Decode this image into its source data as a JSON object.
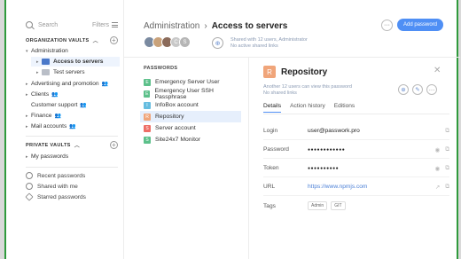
{
  "sidebar": {
    "search_placeholder": "Search",
    "filters_label": "Filters",
    "org_vaults_title": "ORGANIZATION VAULTS",
    "org_items": [
      {
        "label": "Administration"
      },
      {
        "label": "Access to servers"
      },
      {
        "label": "Test servers"
      },
      {
        "label": "Advertising and promotion"
      },
      {
        "label": "Clients"
      },
      {
        "label": "Customer support"
      },
      {
        "label": "Finance"
      },
      {
        "label": "Mail accounts"
      }
    ],
    "private_vaults_title": "PRIVATE VAULTS",
    "private_items": [
      {
        "label": "My passwords"
      }
    ],
    "utilities": [
      {
        "label": "Recent passwords"
      },
      {
        "label": "Shared with me"
      },
      {
        "label": "Starred passwords"
      }
    ]
  },
  "header": {
    "breadcrumb_parent": "Administration",
    "breadcrumb_current": "Access to servers",
    "avatar_letters": [
      "",
      "",
      "",
      "C",
      "S"
    ],
    "shared_line1": "Shared with 12 users, Administrator",
    "shared_line2": "No active shared links",
    "more_glyph": "···",
    "add_password_label": "Add password"
  },
  "list": {
    "title": "PASSWORDS",
    "items": [
      {
        "badge": "E",
        "label": "Emergency Server User",
        "color": "#5cc08a"
      },
      {
        "badge": "E",
        "label": "Emergency User SSH Passphrase",
        "color": "#5cc08a"
      },
      {
        "badge": "I",
        "label": "InfoBox account",
        "color": "#66bde0"
      },
      {
        "badge": "R",
        "label": "Repository",
        "color": "#f0a57a"
      },
      {
        "badge": "S",
        "label": "Server account",
        "color": "#ee6e66"
      },
      {
        "badge": "S",
        "label": "Site24x7 Monitor",
        "color": "#5cc08a"
      }
    ]
  },
  "detail": {
    "badge": "R",
    "title": "Repository",
    "sub_line1": "Another 12 users can view this password",
    "sub_line2": "No shared links",
    "tabs": [
      "Details",
      "Action history",
      "Editions"
    ],
    "fields": [
      {
        "label": "Login",
        "value": "user@passwork.pro"
      },
      {
        "label": "Password",
        "value": "●●●●●●●●●●●●"
      },
      {
        "label": "Token",
        "value": "●●●●●●●●●●"
      },
      {
        "label": "URL",
        "value": "https://www.npmjs.com"
      },
      {
        "label": "Tags",
        "value": ""
      }
    ],
    "tags": [
      "Admin",
      "GIT"
    ]
  }
}
